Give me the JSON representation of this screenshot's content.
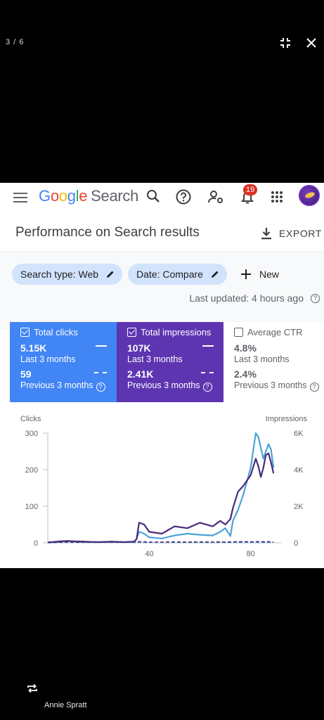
{
  "viewer": {
    "counter": "3 / 6",
    "credit": "Annie Spratt"
  },
  "topbar": {
    "logo_letters": [
      "G",
      "o",
      "o",
      "g",
      "l",
      "e"
    ],
    "product": "Search",
    "notifications_count": "19",
    "icons": [
      "menu-icon",
      "search-icon",
      "help-icon",
      "manage-users-icon",
      "bell-icon",
      "apps-icon"
    ]
  },
  "page": {
    "title": "Performance on Search results",
    "export_label": "EXPORT"
  },
  "filters": {
    "search_type": "Search type: Web",
    "date": "Date: Compare",
    "new_label": "New",
    "last_updated": "Last updated: 4 hours ago"
  },
  "metrics": {
    "clicks": {
      "label": "Total clicks",
      "current": "5.15K",
      "current_period": "Last 3 months",
      "previous": "59",
      "previous_period": "Previous 3 months",
      "selected": true
    },
    "impressions": {
      "label": "Total impressions",
      "current": "107K",
      "current_period": "Last 3 months",
      "previous": "2.41K",
      "previous_period": "Previous 3 months",
      "selected": true
    },
    "ctr": {
      "label": "Average CTR",
      "current": "4.8%",
      "current_period": "Last 3 months",
      "previous": "2.4%",
      "previous_period": "Previous 3 months",
      "selected": false
    }
  },
  "colors": {
    "clicks": "#4285f4",
    "impressions": "#5e35b1",
    "clicks_line": "#4aa3d8",
    "impressions_line": "#4a2c7a"
  },
  "chart_data": {
    "type": "line",
    "ylabel_left": "Clicks",
    "ylabel_right": "Impressions",
    "y_left_ticks": [
      "300",
      "200",
      "100",
      "0"
    ],
    "y_right_ticks": [
      "6K",
      "4K",
      "2K",
      "0"
    ],
    "x_ticks": [
      "40",
      "80"
    ],
    "ylim_left": [
      0,
      300
    ],
    "ylim_right": [
      0,
      6000
    ],
    "xlim": [
      0,
      92
    ],
    "grid": false,
    "x": [
      0,
      5,
      8,
      10,
      15,
      20,
      25,
      30,
      34,
      35,
      36,
      38,
      40,
      45,
      50,
      55,
      60,
      65,
      68,
      70,
      72,
      73,
      75,
      77,
      80,
      82,
      83,
      84,
      85,
      86,
      87,
      88,
      89
    ],
    "series": [
      {
        "axis": "left",
        "values": [
          1,
          3,
          5,
          4,
          2,
          2,
          3,
          2,
          3,
          10,
          30,
          25,
          15,
          12,
          20,
          25,
          22,
          20,
          30,
          40,
          18,
          60,
          90,
          130,
          205,
          300,
          290,
          260,
          230,
          250,
          270,
          255,
          205
        ]
      },
      {
        "axis": "right",
        "values": [
          20,
          80,
          100,
          80,
          60,
          40,
          60,
          40,
          60,
          200,
          1100,
          1000,
          600,
          500,
          900,
          800,
          1100,
          900,
          1200,
          1000,
          1300,
          1900,
          2800,
          3100,
          3700,
          4600,
          4200,
          3600,
          4100,
          4800,
          4900,
          4400,
          3800
        ]
      },
      {
        "axis": "left",
        "dashed": true,
        "values": [
          0,
          1,
          1,
          1,
          1,
          1,
          1,
          1,
          1,
          1,
          1,
          1,
          1,
          1,
          1,
          1,
          1,
          1,
          1,
          1,
          1,
          1,
          1,
          1,
          1,
          1,
          1,
          1,
          1,
          1,
          1,
          1,
          1
        ]
      },
      {
        "axis": "right",
        "dashed": true,
        "values": [
          10,
          30,
          40,
          30,
          40,
          30,
          40,
          30,
          40,
          50,
          60,
          50,
          40,
          40,
          50,
          40,
          50,
          40,
          50,
          40,
          50,
          50,
          60,
          60,
          50,
          60,
          60,
          50,
          60,
          50,
          60,
          50,
          50
        ]
      }
    ]
  }
}
